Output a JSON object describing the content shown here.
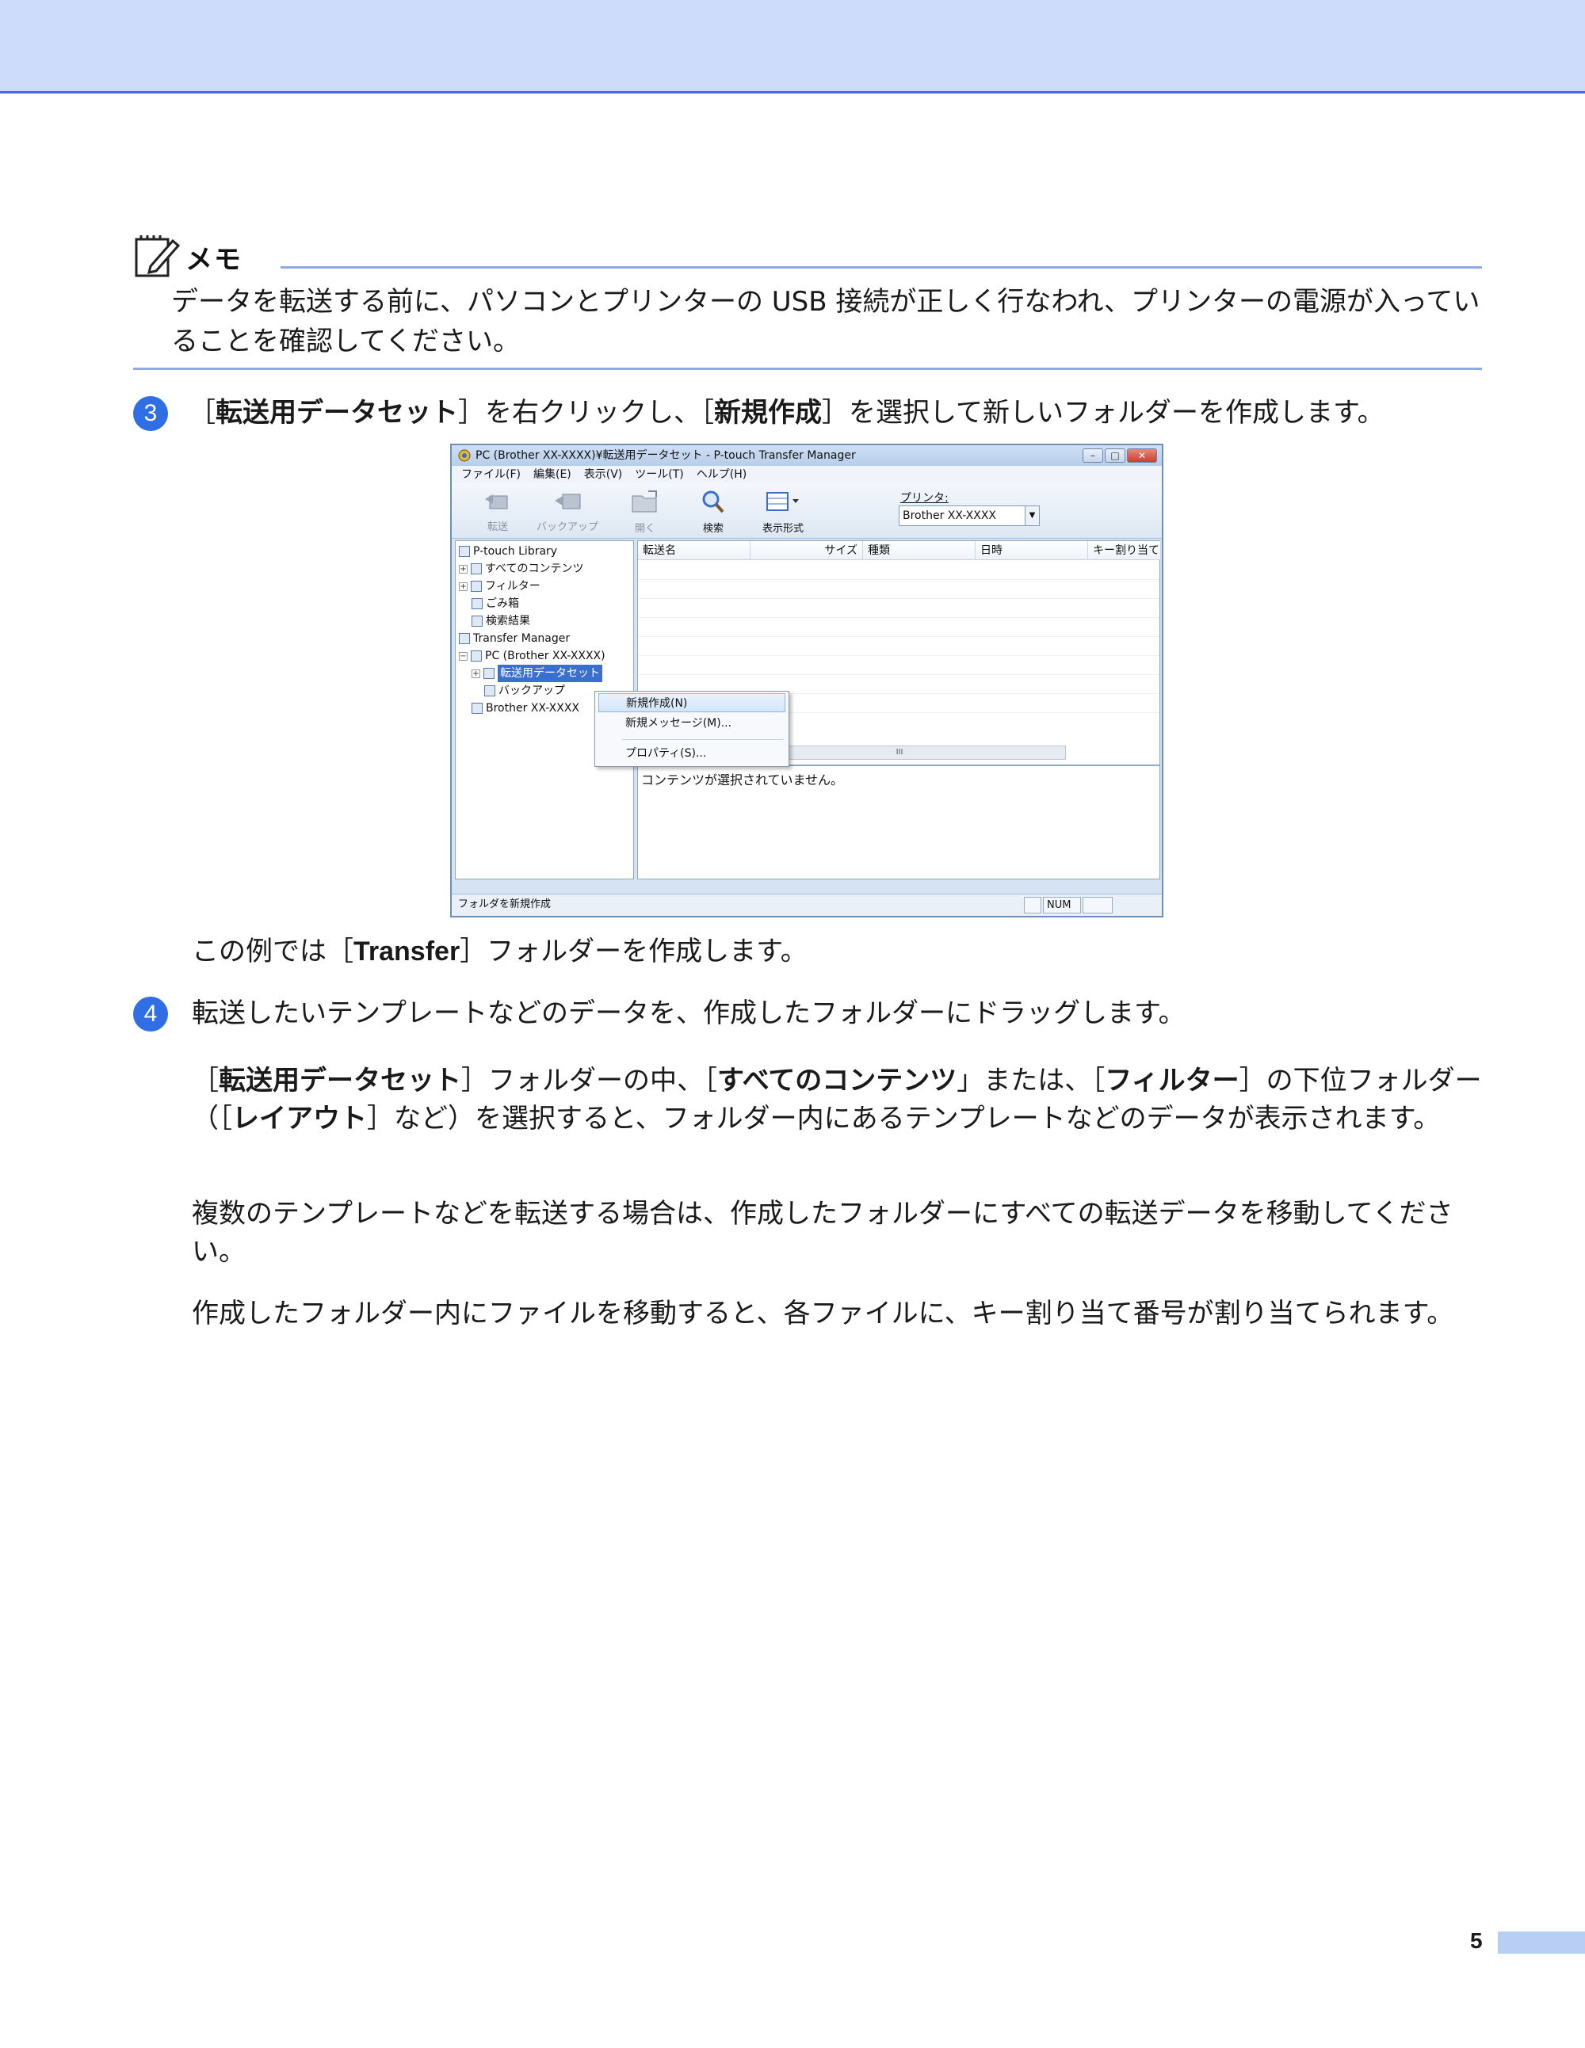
{
  "memo": {
    "title": "メモ",
    "text": "データを転送する前に、パソコンとプリンターの USB 接続が正しく行なわれ、プリンターの電源が入っていることを確認してください。"
  },
  "step3": {
    "number": "3",
    "t1": "［",
    "b1": "転送用データセット",
    "t2": "］を右クリックし、［",
    "b2": "新規作成",
    "t3": "］を選択して新しいフォルダーを作成します。"
  },
  "window": {
    "title": "PC (Brother XX-XXXX)¥転送用データセット - P-touch Transfer Manager",
    "menu": [
      "ファイル(F)",
      "編集(E)",
      "表示(V)",
      "ツール(T)",
      "ヘルプ(H)"
    ],
    "toolbar": {
      "transfer": "転送",
      "backup": "バックアップ",
      "open": "開く",
      "search": "検索",
      "view": "表示形式"
    },
    "printer_label": "プリンタ:",
    "printer_value": "Brother XX-XXXX",
    "tree": {
      "library": "P-touch Library",
      "all_contents": "すべてのコンテンツ",
      "filter": "フィルター",
      "trash": "ごみ箱",
      "search_results": "検索結果",
      "transfer_manager": "Transfer Manager",
      "pc": "PC (Brother XX-XXXX)",
      "transfer_dataset": "転送用データセット",
      "backup": "バックアップ",
      "printer": "Brother XX-XXXX"
    },
    "columns": [
      "転送名",
      "サイズ",
      "種類",
      "日時",
      "キー割り当て"
    ],
    "context_menu": [
      "新規作成(N)",
      "新規メッセージ(M)...",
      "プロパティ(S)..."
    ],
    "scroll_mark": "III",
    "preview_text": "コンテンツが選択されていません。",
    "status_text": "フォルダを新規作成",
    "status_num": "NUM"
  },
  "example": {
    "t1": "この例では［",
    "b1": "Transfer",
    "t2": "］フォルダーを作成します。"
  },
  "step4": {
    "number": "4",
    "text": "転送したいテンプレートなどのデータを、作成したフォルダーにドラッグします。"
  },
  "para1": {
    "t1": "［",
    "b1": "転送用データセット",
    "t2": "］フォルダーの中、［",
    "b2": "すべてのコンテンツ",
    "t3": "」または、［",
    "b3": "フィルター",
    "t4": "］の下位フォルダー（［",
    "b4": "レイアウト",
    "t5": "］など）を選択すると、フォルダー内にあるテンプレートなどのデータが表示されます。"
  },
  "para2": "複数のテンプレートなどを転送する場合は、作成したフォルダーにすべての転送データを移動してください。",
  "para3": "作成したフォルダー内にファイルを移動すると、各ファイルに、キー割り当て番号が割り当てられます。",
  "page_number": "5",
  "colors": {
    "accent": "#2f6ee4",
    "band": "#ccdcfa",
    "rule": "#8cabe6"
  }
}
